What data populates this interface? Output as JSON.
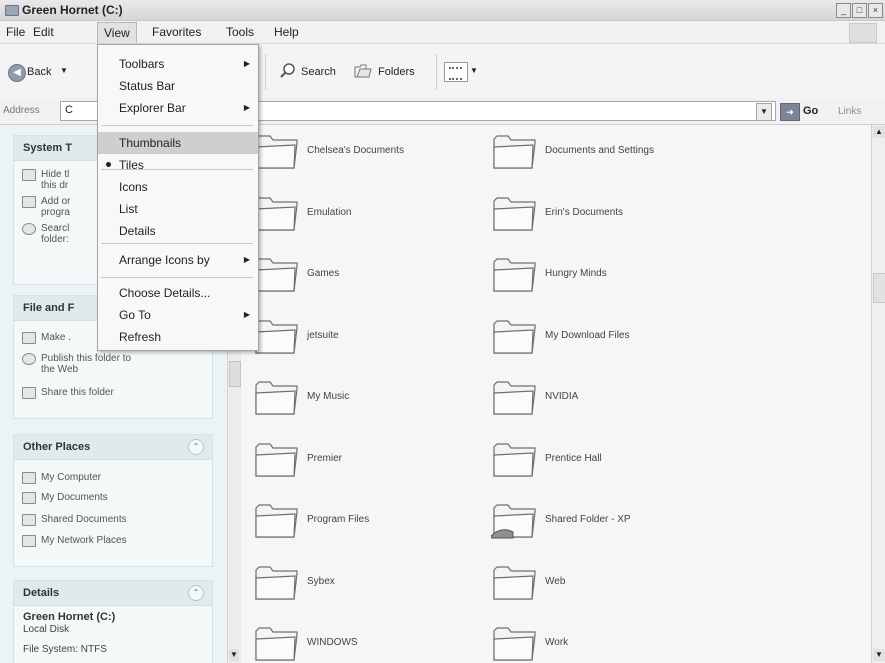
{
  "window": {
    "title": "Green Hornet (C:)"
  },
  "menubar": {
    "items": [
      "File",
      "Edit",
      "View",
      "Favorites",
      "Tools",
      "Help"
    ]
  },
  "toolbar": {
    "back_label": "Back",
    "search_label": "Search",
    "folders_label": "Folders"
  },
  "address": {
    "label": "Address",
    "value": "C",
    "go_label": "Go",
    "links_label": "Links"
  },
  "view_menu": {
    "items": [
      {
        "label": "Toolbars",
        "submenu": true
      },
      {
        "label": "Status Bar"
      },
      {
        "label": "Explorer Bar",
        "submenu": true
      },
      {
        "label": "Thumbnails",
        "highlighted": true
      },
      {
        "label": "Tiles",
        "selected": true
      },
      {
        "label": "Icons"
      },
      {
        "label": "List"
      },
      {
        "label": "Details"
      },
      {
        "label": "Arrange Icons by",
        "submenu": true
      },
      {
        "label": "Choose Details..."
      },
      {
        "label": "Go To",
        "submenu": true
      },
      {
        "label": "Refresh"
      }
    ]
  },
  "left_pane": {
    "system_tasks": {
      "title": "System T",
      "tasks": [
        {
          "icon": "hide-icon",
          "text": "Hide tl\nthis dr"
        },
        {
          "icon": "add-remove-icon",
          "text": "Add or\nprogra"
        },
        {
          "icon": "search-icon",
          "text": "Searcl\nfolder:"
        }
      ]
    },
    "file_folder_tasks": {
      "title": "File and F",
      "tasks": [
        {
          "icon": "new-folder-icon",
          "text": "Make ."
        },
        {
          "icon": "globe-icon",
          "text": "Publish this folder to\nthe Web"
        },
        {
          "icon": "share-icon",
          "text": "Share this folder"
        }
      ]
    },
    "other_places": {
      "title": "Other Places",
      "links": [
        {
          "icon": "computer-icon",
          "text": "My Computer"
        },
        {
          "icon": "documents-icon",
          "text": "My Documents"
        },
        {
          "icon": "shared-folder-icon",
          "text": "Shared Documents"
        },
        {
          "icon": "network-icon",
          "text": "My Network Places"
        }
      ]
    },
    "details": {
      "title": "Details",
      "name": "Green Hornet (C:)",
      "type": "Local Disk",
      "filesystem": "File System: NTFS"
    }
  },
  "folders": [
    "Chelsea's Documents",
    "Documents and Settings",
    "Emulation",
    "Erin's Documents",
    "Games",
    "Hungry Minds",
    "jetsuite",
    "My Download Files",
    "My Music",
    "NVIDIA",
    "Premier",
    "Prentice Hall",
    "Program Files",
    "Shared Folder - XP",
    "Sybex",
    "Web",
    "WINDOWS",
    "Work"
  ]
}
